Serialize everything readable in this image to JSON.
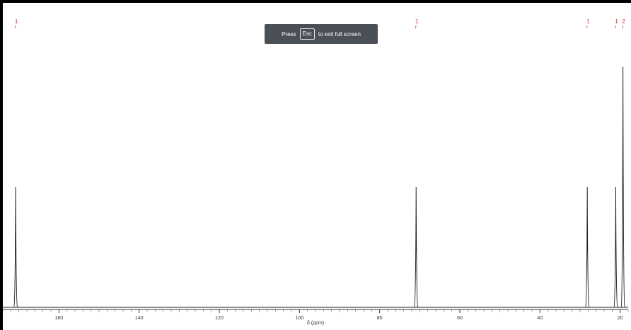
{
  "toast": {
    "press": "Press",
    "key": "Esc",
    "suffix": "to exit full screen"
  },
  "spectrum": {
    "x_axis": {
      "label": "δ (ppm)",
      "ticks": [
        160,
        140,
        120,
        100,
        80,
        60,
        40,
        20
      ],
      "range": [
        174,
        18
      ]
    },
    "peaks": [
      {
        "ppm": 170.8,
        "intensity": 0.5,
        "integral": "1"
      },
      {
        "ppm": 70.9,
        "intensity": 0.5,
        "integral": "1"
      },
      {
        "ppm": 28.2,
        "intensity": 0.5,
        "integral": "1"
      },
      {
        "ppm": 21.1,
        "intensity": 0.5,
        "integral": "1"
      },
      {
        "ppm": 19.3,
        "intensity": 1.0,
        "integral": "2"
      }
    ],
    "colors": {
      "trace": "#222222",
      "integral": "#e03030"
    }
  }
}
